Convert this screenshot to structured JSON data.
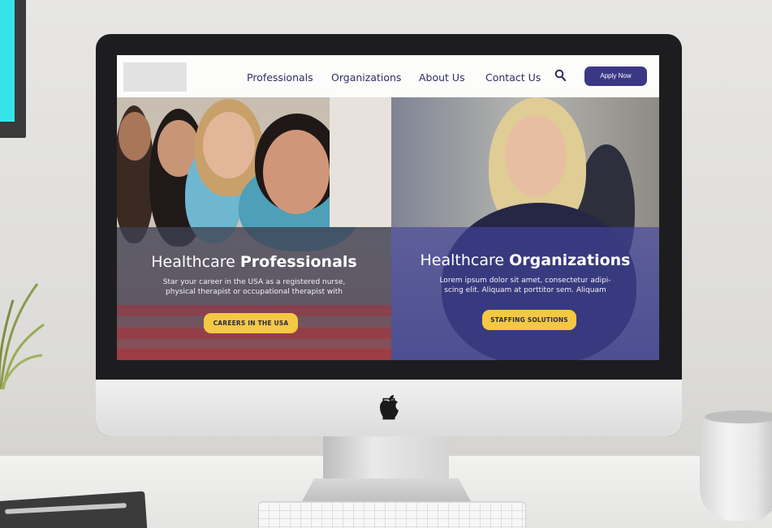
{
  "nav": {
    "items": [
      "Professionals",
      "Organizations",
      "About Us",
      "Contact Us"
    ],
    "apply_label": "Apply Now",
    "search_icon": "search-icon"
  },
  "hero_left": {
    "title_light": "Healthcare",
    "title_bold": "Professionals",
    "text_line1": "Star your career in the USA as a registered nurse,",
    "text_line2": "physical therapist or occupational therapist with",
    "cta": "CAREERS IN THE USA"
  },
  "hero_right": {
    "title_light": "Healthcare",
    "title_bold": "Organizations",
    "text_line1": "Lorem ipsum dolor sit amet, consectetur adipi-",
    "text_line2": "scing elit. Aliquam at porttitor sem. Aliquam",
    "cta": "STAFFING SOLUTIONS"
  },
  "colors": {
    "brand_navy": "#3a3785",
    "nav_text": "#2f2e63",
    "cta_yellow": "#f5c844"
  }
}
